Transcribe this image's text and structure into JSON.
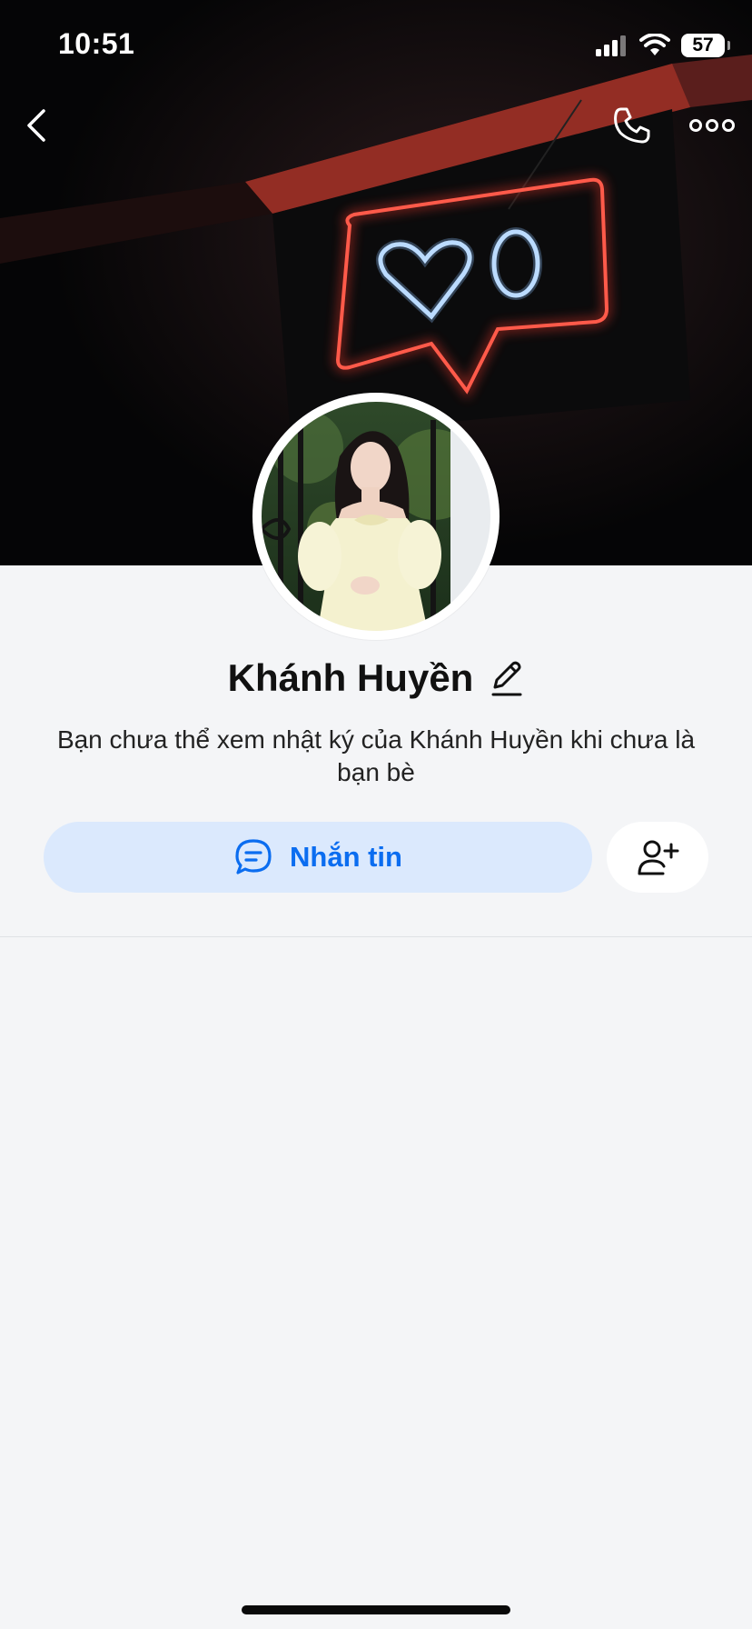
{
  "status_bar": {
    "time": "10:51",
    "battery": "57",
    "icons": [
      "cellular-signal-icon",
      "wifi-icon",
      "battery-icon"
    ]
  },
  "nav": {
    "icons": [
      "back-chevron-icon",
      "phone-icon",
      "more-dots-icon"
    ]
  },
  "profile": {
    "name": "Khánh Huyền",
    "notice": "Bạn chưa thể xem nhật ký của Khánh Huyền khi chưa là bạn bè"
  },
  "actions": {
    "message_label": "Nhắn tin",
    "message_icon": "chat-bubble-icon",
    "add_friend_icon": "add-friend-icon"
  },
  "colors": {
    "accent": "#0b6df0",
    "message_button_bg": "#dbe9fd",
    "background": "#f4f5f7",
    "neon_red": "#ff3b2f"
  }
}
